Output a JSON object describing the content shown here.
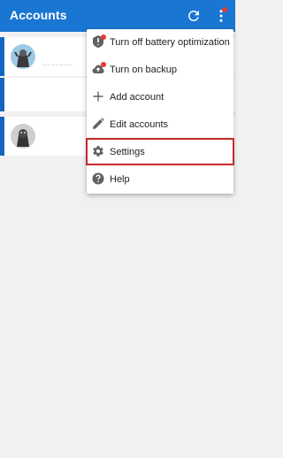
{
  "appbar": {
    "title": "Accounts",
    "refresh_icon": "refresh-icon",
    "more_icon": "more-vert-icon",
    "color": "#1976d2"
  },
  "accounts": [
    {
      "avatar": "user-avatar"
    },
    {
      "avatar": ""
    },
    {
      "avatar": "user-avatar"
    }
  ],
  "menu": {
    "items": [
      {
        "label": "Turn off battery optimization",
        "icon": "battery-icon",
        "badge": true
      },
      {
        "label": "Turn on backup",
        "icon": "cloud-icon",
        "badge": true
      },
      {
        "label": "Add account",
        "icon": "plus-icon"
      },
      {
        "label": "Edit accounts",
        "icon": "pencil-icon"
      },
      {
        "label": "Settings",
        "icon": "gear-icon",
        "highlighted": true
      },
      {
        "label": "Help",
        "icon": "help-icon"
      }
    ]
  },
  "colors": {
    "accent": "#1565c0",
    "badge": "#e53935",
    "highlight": "#c62828"
  }
}
